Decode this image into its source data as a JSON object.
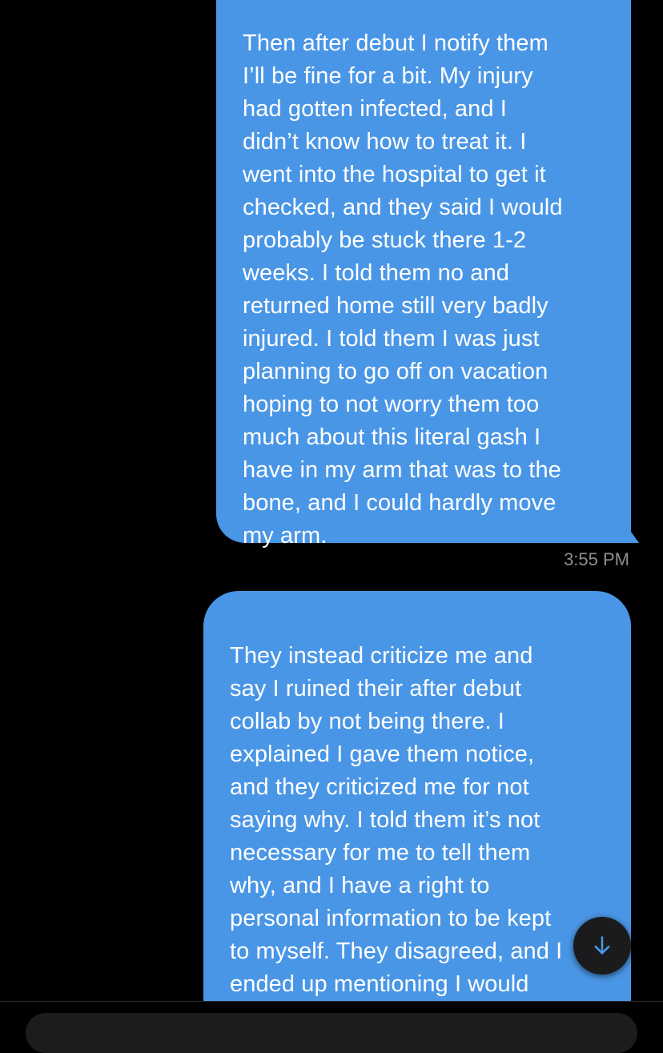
{
  "messages": [
    {
      "text": "Then after debut I notify them\nI’ll be fine for a bit. My injury\nhad gotten infected, and I\ndidn’t know how to treat it. I\nwent into the hospital to get it\nchecked, and they said I would\nprobably be stuck there 1-2\nweeks. I told them no and\nreturned home still very badly\ninjured. I told them I was just\nplanning to go off on vacation\nhoping to not worry them too\nmuch about this literal gash I\nhave in my arm that was to the\nbone, and I could hardly move\nmy arm.",
      "timestamp": "3:55 PM"
    },
    {
      "text": "They instead criticize me and\nsay I ruined their after debut\ncollab by not being there. I\nexplained I gave them notice,\nand they criticized me for not\nsaying why. I told them it’s not\nnecessary for me to tell them\nwhy, and I have a right to\npersonal information to be kept\nto myself. They disagreed, and I\nended up mentioning I would\nlike to leave."
    }
  ],
  "scroll_button": {
    "icon": "arrow-down-icon"
  },
  "colors": {
    "background": "#000000",
    "bubble": "#4a96e6",
    "bubble_text": "#ffffff",
    "timestamp": "#8e8e93",
    "scroll_button_bg": "#1b1b1d",
    "scroll_button_icon": "#4a96e6"
  }
}
